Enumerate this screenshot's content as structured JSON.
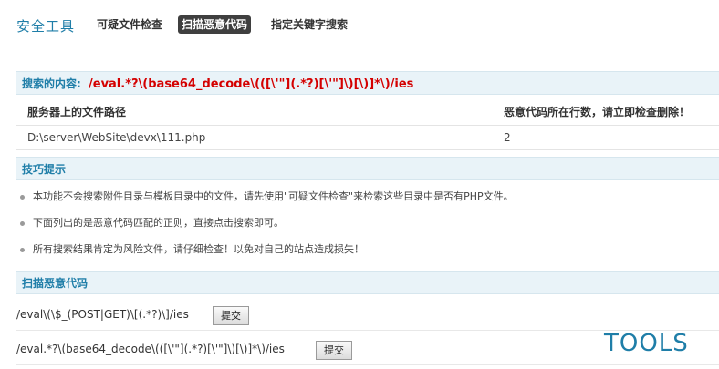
{
  "header": {
    "title": "安全工具",
    "tabs": [
      {
        "label": "可疑文件检查",
        "active": false
      },
      {
        "label": "扫描恶意代码",
        "active": true
      },
      {
        "label": "指定关键字搜索",
        "active": false
      }
    ]
  },
  "search": {
    "label": "搜索的内容:",
    "pattern": "/eval.*?\\(base64_decode\\(([\\'\"](.*?)[\\'\"]\\)[\\)]*\\)/ies"
  },
  "results": {
    "columns": [
      "服务器上的文件路径",
      "恶意代码所在行数，请立即检查删除！"
    ],
    "rows": [
      {
        "path": "D:\\server\\WebSite\\devx\\111.php",
        "line": "2"
      }
    ]
  },
  "tips": {
    "header": "技巧提示",
    "items": [
      "本功能不会搜索附件目录与模板目录中的文件，请先使用\"可疑文件检查\"来检索这些目录中是否有PHP文件。",
      "下面列出的是恶意代码匹配的正则，直接点击搜索即可。",
      "所有搜索结果肯定为风险文件，请仔细检查！以免对自己的站点造成损失！"
    ]
  },
  "scan": {
    "header": "扫描恶意代码",
    "patterns": [
      {
        "regex": "/eval\\(\\$_(POST|GET)\\[(.*?)\\]/ies",
        "button": "提交"
      },
      {
        "regex": "/eval.*?\\(base64_decode\\(([\\'\"](.*?)[\\'\"]\\)[\\)]*\\)/ies",
        "button": "提交"
      }
    ]
  },
  "watermark": "TOOLS",
  "colors": {
    "accent": "#1f7ea8",
    "danger": "#d40000",
    "section_bg": "#e9f3f8"
  }
}
